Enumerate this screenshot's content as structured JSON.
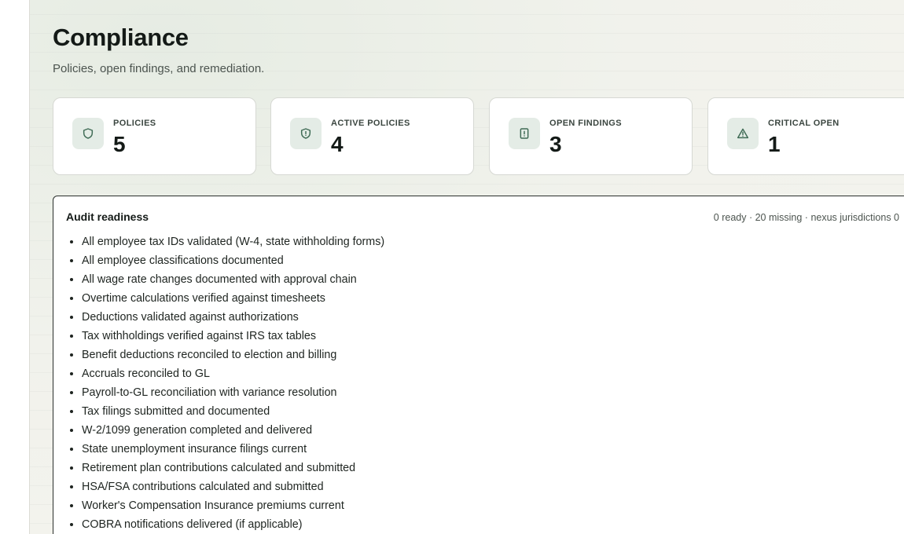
{
  "page": {
    "title": "Compliance",
    "subtitle": "Policies, open findings, and remediation."
  },
  "stats": [
    {
      "label": "POLICIES",
      "value": "5",
      "icon": "shield-icon"
    },
    {
      "label": "ACTIVE POLICIES",
      "value": "4",
      "icon": "shield-alert-icon"
    },
    {
      "label": "OPEN FINDINGS",
      "value": "3",
      "icon": "file-alert-icon"
    },
    {
      "label": "CRITICAL OPEN",
      "value": "1",
      "icon": "warning-triangle-icon"
    }
  ],
  "audit_readiness": {
    "title": "Audit readiness",
    "meta": "0 ready · 20 missing · nexus jurisdictions 0",
    "items": [
      "All employee tax IDs validated (W-4, state withholding forms)",
      "All employee classifications documented",
      "All wage rate changes documented with approval chain",
      "Overtime calculations verified against timesheets",
      "Deductions validated against authorizations",
      "Tax withholdings verified against IRS tax tables",
      "Benefit deductions reconciled to election and billing",
      "Accruals reconciled to GL",
      "Payroll-to-GL reconciliation with variance resolution",
      "Tax filings submitted and documented",
      "W-2/1099 generation completed and delivered",
      "State unemployment insurance filings current",
      "Retirement plan contributions calculated and submitted",
      "HSA/FSA contributions calculated and submitted",
      "Worker's Compensation Insurance premiums current",
      "COBRA notifications delivered (if applicable)"
    ]
  },
  "colors": {
    "accent": "#3f6b55",
    "icon_bg": "#e4ece6",
    "card_border": "#d6d8d3",
    "panel_border": "#2a2f2c"
  }
}
